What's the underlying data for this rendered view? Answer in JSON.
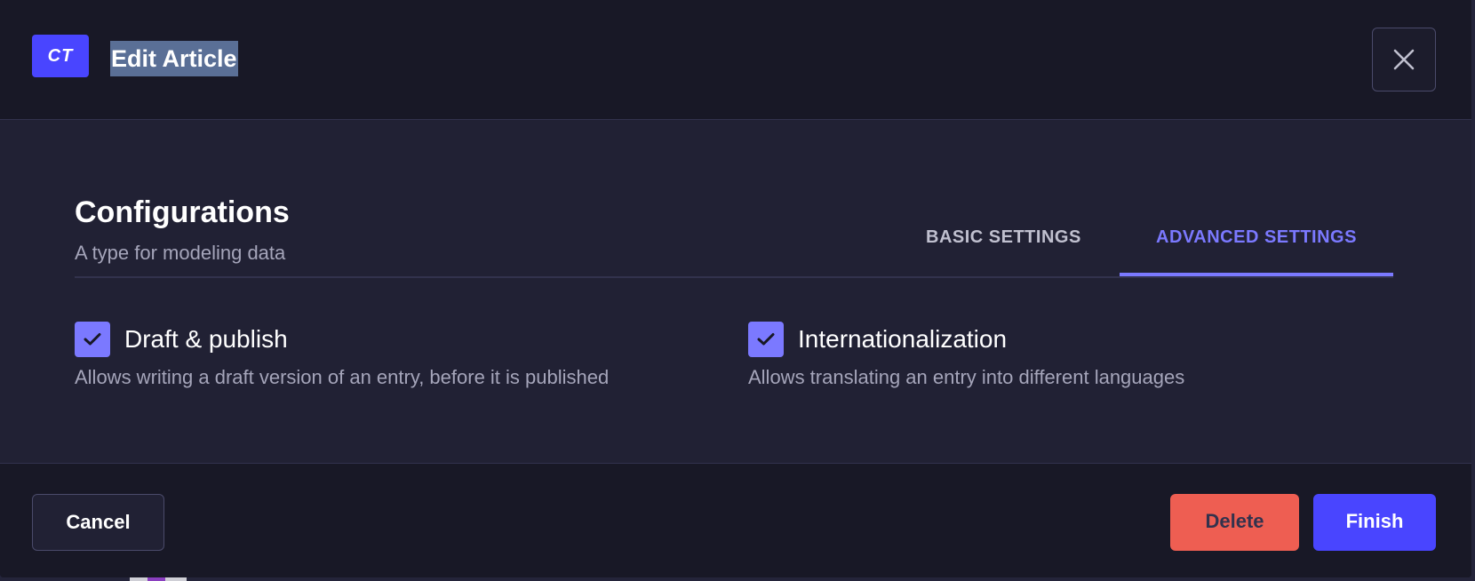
{
  "header": {
    "badge": "CT",
    "title": "Edit Article",
    "close_icon": "close-icon"
  },
  "body": {
    "title": "Configurations",
    "subtitle": "A type for modeling data",
    "tabs": [
      {
        "label": "BASIC SETTINGS",
        "active": false
      },
      {
        "label": "ADVANCED SETTINGS",
        "active": true
      }
    ],
    "options": [
      {
        "label": "Draft & publish",
        "description": "Allows writing a draft version of an entry, before it is published",
        "checked": true
      },
      {
        "label": "Internationalization",
        "description": "Allows translating an entry into different languages",
        "checked": true
      }
    ]
  },
  "footer": {
    "cancel_label": "Cancel",
    "delete_label": "Delete",
    "finish_label": "Finish"
  },
  "colors": {
    "primary": "#4945ff",
    "accent": "#7b79ff",
    "danger": "#ee5e52",
    "background": "#181826",
    "surface": "#212134"
  }
}
